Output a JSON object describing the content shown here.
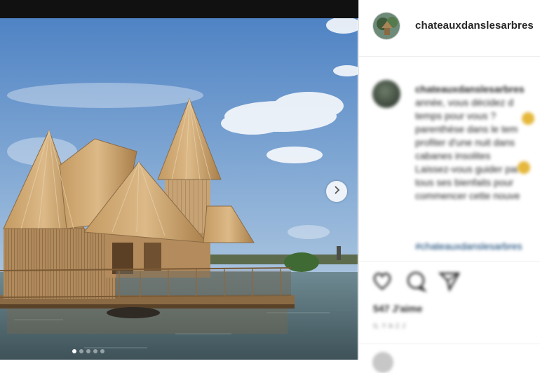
{
  "post": {
    "username": "chateauxdanslesarbres",
    "caption_lines": [
      "chateauxdanslesarbres",
      "année, vous décidez d",
      "temps pour vous ?",
      "parenthèse dans le tem",
      "profiter d'une nuit dans",
      "cabanes insolites",
      "Laissez-vous guider par",
      "tous ses bienfaits pour",
      "commencer cette nouve"
    ],
    "hashtag": "#chateauxdanslesarbres",
    "likes": "547 J'aime",
    "date": "IL Y A 2 J",
    "carousel": {
      "count": 5,
      "active": 0
    }
  },
  "icons": {
    "like": "heart-icon",
    "comment": "comment-icon",
    "share": "send-icon",
    "next": "chevron-right-icon"
  },
  "colors": {
    "text": "#262626",
    "hashtag": "#00376b",
    "divider": "#dbdbdb"
  }
}
